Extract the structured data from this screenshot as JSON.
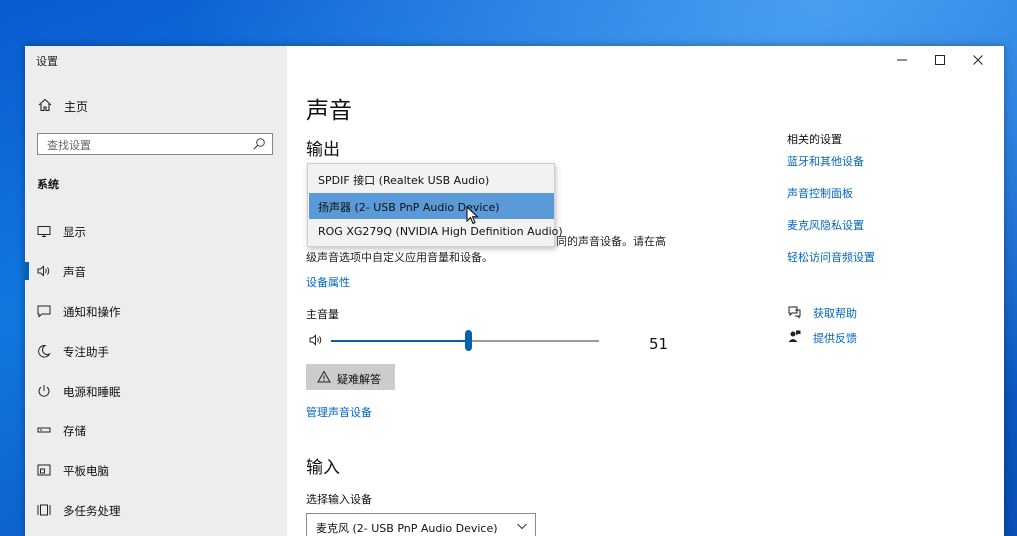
{
  "window": {
    "title": "设置"
  },
  "sidebar": {
    "home_label": "主页",
    "search_placeholder": "查找设置",
    "section_title": "系统",
    "items": [
      {
        "label": "显示",
        "icon": "monitor-icon"
      },
      {
        "label": "声音",
        "icon": "speaker-icon",
        "active": true
      },
      {
        "label": "通知和操作",
        "icon": "notification-icon"
      },
      {
        "label": "专注助手",
        "icon": "moon-icon"
      },
      {
        "label": "电源和睡眠",
        "icon": "power-icon"
      },
      {
        "label": "存储",
        "icon": "storage-icon"
      },
      {
        "label": "平板电脑",
        "icon": "tablet-icon"
      },
      {
        "label": "多任务处理",
        "icon": "multitask-icon"
      }
    ]
  },
  "main": {
    "title": "声音",
    "output": {
      "heading": "输出",
      "dropdown_options": [
        "SPDIF 接口 (Realtek USB Audio)",
        "扬声器 (2- USB PnP Audio Device)",
        "ROG XG279Q (NVIDIA High Definition Audio)"
      ],
      "selected_index": 1,
      "description_line1": "同的声音设备。请在高",
      "description_line2": "级声音选项中自定义应用音量和设备。",
      "device_properties_link": "设备属性",
      "master_volume_label": "主音量",
      "volume_value": "51",
      "volume_fraction": 0.51,
      "troubleshoot_label": "疑难解答",
      "manage_devices_link": "管理声音设备"
    },
    "input": {
      "heading": "输入",
      "select_label": "选择输入设备",
      "selected_device": "麦克风 (2- USB PnP Audio Device)"
    }
  },
  "related": {
    "title": "相关的设置",
    "links": [
      "蓝牙和其他设备",
      "声音控制面板",
      "麦克风隐私设置",
      "轻松访问音频设置"
    ],
    "get_help": "获取帮助",
    "feedback": "提供反馈"
  },
  "colors": {
    "accent": "#0063b1",
    "link": "#0067c0",
    "selected_option": "#5b9ad8"
  }
}
